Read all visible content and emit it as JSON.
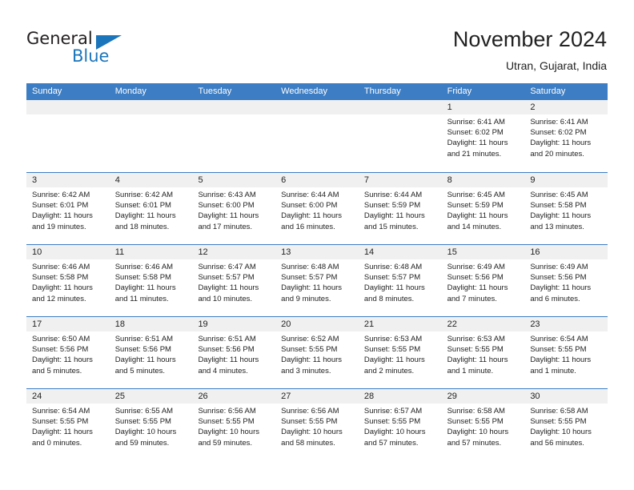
{
  "brand": {
    "name_part1": "General",
    "name_part2": "Blue",
    "logo_color": "#1b75bb",
    "flag_icon": "triangle-flag-icon"
  },
  "header": {
    "title": "November 2024",
    "subtitle": "Utran, Gujarat, India"
  },
  "colors": {
    "header_blue": "#3c7dc4",
    "daynum_strip": "#f0f0f0",
    "text": "#222222"
  },
  "weekday_headers": [
    "Sunday",
    "Monday",
    "Tuesday",
    "Wednesday",
    "Thursday",
    "Friday",
    "Saturday"
  ],
  "weeks": [
    [
      {
        "day": "",
        "sunrise": "",
        "sunset": "",
        "daylight_line1": "",
        "daylight_line2": "",
        "empty": true
      },
      {
        "day": "",
        "sunrise": "",
        "sunset": "",
        "daylight_line1": "",
        "daylight_line2": "",
        "empty": true
      },
      {
        "day": "",
        "sunrise": "",
        "sunset": "",
        "daylight_line1": "",
        "daylight_line2": "",
        "empty": true
      },
      {
        "day": "",
        "sunrise": "",
        "sunset": "",
        "daylight_line1": "",
        "daylight_line2": "",
        "empty": true
      },
      {
        "day": "",
        "sunrise": "",
        "sunset": "",
        "daylight_line1": "",
        "daylight_line2": "",
        "empty": true
      },
      {
        "day": "1",
        "sunrise": "Sunrise: 6:41 AM",
        "sunset": "Sunset: 6:02 PM",
        "daylight_line1": "Daylight: 11 hours",
        "daylight_line2": "and 21 minutes."
      },
      {
        "day": "2",
        "sunrise": "Sunrise: 6:41 AM",
        "sunset": "Sunset: 6:02 PM",
        "daylight_line1": "Daylight: 11 hours",
        "daylight_line2": "and 20 minutes."
      }
    ],
    [
      {
        "day": "3",
        "sunrise": "Sunrise: 6:42 AM",
        "sunset": "Sunset: 6:01 PM",
        "daylight_line1": "Daylight: 11 hours",
        "daylight_line2": "and 19 minutes."
      },
      {
        "day": "4",
        "sunrise": "Sunrise: 6:42 AM",
        "sunset": "Sunset: 6:01 PM",
        "daylight_line1": "Daylight: 11 hours",
        "daylight_line2": "and 18 minutes."
      },
      {
        "day": "5",
        "sunrise": "Sunrise: 6:43 AM",
        "sunset": "Sunset: 6:00 PM",
        "daylight_line1": "Daylight: 11 hours",
        "daylight_line2": "and 17 minutes."
      },
      {
        "day": "6",
        "sunrise": "Sunrise: 6:44 AM",
        "sunset": "Sunset: 6:00 PM",
        "daylight_line1": "Daylight: 11 hours",
        "daylight_line2": "and 16 minutes."
      },
      {
        "day": "7",
        "sunrise": "Sunrise: 6:44 AM",
        "sunset": "Sunset: 5:59 PM",
        "daylight_line1": "Daylight: 11 hours",
        "daylight_line2": "and 15 minutes."
      },
      {
        "day": "8",
        "sunrise": "Sunrise: 6:45 AM",
        "sunset": "Sunset: 5:59 PM",
        "daylight_line1": "Daylight: 11 hours",
        "daylight_line2": "and 14 minutes."
      },
      {
        "day": "9",
        "sunrise": "Sunrise: 6:45 AM",
        "sunset": "Sunset: 5:58 PM",
        "daylight_line1": "Daylight: 11 hours",
        "daylight_line2": "and 13 minutes."
      }
    ],
    [
      {
        "day": "10",
        "sunrise": "Sunrise: 6:46 AM",
        "sunset": "Sunset: 5:58 PM",
        "daylight_line1": "Daylight: 11 hours",
        "daylight_line2": "and 12 minutes."
      },
      {
        "day": "11",
        "sunrise": "Sunrise: 6:46 AM",
        "sunset": "Sunset: 5:58 PM",
        "daylight_line1": "Daylight: 11 hours",
        "daylight_line2": "and 11 minutes."
      },
      {
        "day": "12",
        "sunrise": "Sunrise: 6:47 AM",
        "sunset": "Sunset: 5:57 PM",
        "daylight_line1": "Daylight: 11 hours",
        "daylight_line2": "and 10 minutes."
      },
      {
        "day": "13",
        "sunrise": "Sunrise: 6:48 AM",
        "sunset": "Sunset: 5:57 PM",
        "daylight_line1": "Daylight: 11 hours",
        "daylight_line2": "and 9 minutes."
      },
      {
        "day": "14",
        "sunrise": "Sunrise: 6:48 AM",
        "sunset": "Sunset: 5:57 PM",
        "daylight_line1": "Daylight: 11 hours",
        "daylight_line2": "and 8 minutes."
      },
      {
        "day": "15",
        "sunrise": "Sunrise: 6:49 AM",
        "sunset": "Sunset: 5:56 PM",
        "daylight_line1": "Daylight: 11 hours",
        "daylight_line2": "and 7 minutes."
      },
      {
        "day": "16",
        "sunrise": "Sunrise: 6:49 AM",
        "sunset": "Sunset: 5:56 PM",
        "daylight_line1": "Daylight: 11 hours",
        "daylight_line2": "and 6 minutes."
      }
    ],
    [
      {
        "day": "17",
        "sunrise": "Sunrise: 6:50 AM",
        "sunset": "Sunset: 5:56 PM",
        "daylight_line1": "Daylight: 11 hours",
        "daylight_line2": "and 5 minutes."
      },
      {
        "day": "18",
        "sunrise": "Sunrise: 6:51 AM",
        "sunset": "Sunset: 5:56 PM",
        "daylight_line1": "Daylight: 11 hours",
        "daylight_line2": "and 5 minutes."
      },
      {
        "day": "19",
        "sunrise": "Sunrise: 6:51 AM",
        "sunset": "Sunset: 5:56 PM",
        "daylight_line1": "Daylight: 11 hours",
        "daylight_line2": "and 4 minutes."
      },
      {
        "day": "20",
        "sunrise": "Sunrise: 6:52 AM",
        "sunset": "Sunset: 5:55 PM",
        "daylight_line1": "Daylight: 11 hours",
        "daylight_line2": "and 3 minutes."
      },
      {
        "day": "21",
        "sunrise": "Sunrise: 6:53 AM",
        "sunset": "Sunset: 5:55 PM",
        "daylight_line1": "Daylight: 11 hours",
        "daylight_line2": "and 2 minutes."
      },
      {
        "day": "22",
        "sunrise": "Sunrise: 6:53 AM",
        "sunset": "Sunset: 5:55 PM",
        "daylight_line1": "Daylight: 11 hours",
        "daylight_line2": "and 1 minute."
      },
      {
        "day": "23",
        "sunrise": "Sunrise: 6:54 AM",
        "sunset": "Sunset: 5:55 PM",
        "daylight_line1": "Daylight: 11 hours",
        "daylight_line2": "and 1 minute."
      }
    ],
    [
      {
        "day": "24",
        "sunrise": "Sunrise: 6:54 AM",
        "sunset": "Sunset: 5:55 PM",
        "daylight_line1": "Daylight: 11 hours",
        "daylight_line2": "and 0 minutes."
      },
      {
        "day": "25",
        "sunrise": "Sunrise: 6:55 AM",
        "sunset": "Sunset: 5:55 PM",
        "daylight_line1": "Daylight: 10 hours",
        "daylight_line2": "and 59 minutes."
      },
      {
        "day": "26",
        "sunrise": "Sunrise: 6:56 AM",
        "sunset": "Sunset: 5:55 PM",
        "daylight_line1": "Daylight: 10 hours",
        "daylight_line2": "and 59 minutes."
      },
      {
        "day": "27",
        "sunrise": "Sunrise: 6:56 AM",
        "sunset": "Sunset: 5:55 PM",
        "daylight_line1": "Daylight: 10 hours",
        "daylight_line2": "and 58 minutes."
      },
      {
        "day": "28",
        "sunrise": "Sunrise: 6:57 AM",
        "sunset": "Sunset: 5:55 PM",
        "daylight_line1": "Daylight: 10 hours",
        "daylight_line2": "and 57 minutes."
      },
      {
        "day": "29",
        "sunrise": "Sunrise: 6:58 AM",
        "sunset": "Sunset: 5:55 PM",
        "daylight_line1": "Daylight: 10 hours",
        "daylight_line2": "and 57 minutes."
      },
      {
        "day": "30",
        "sunrise": "Sunrise: 6:58 AM",
        "sunset": "Sunset: 5:55 PM",
        "daylight_line1": "Daylight: 10 hours",
        "daylight_line2": "and 56 minutes."
      }
    ]
  ]
}
